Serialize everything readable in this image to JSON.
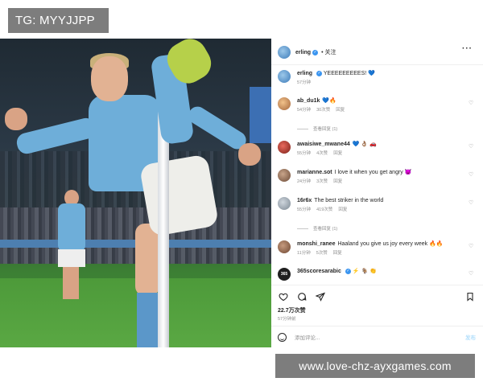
{
  "watermark_top": "TG: MYYJJPP",
  "watermark_bottom": "www.love-chz-ayxgames.com",
  "post": {
    "author": "erling",
    "follow_label": "关注",
    "more_label": "···",
    "caption": {
      "user": "erling",
      "text": "YEEEEEEEEES! 💙",
      "time": "57分钟"
    },
    "comments": [
      {
        "user": "ab_du1k",
        "text": "💙🔥",
        "time": "54分钟",
        "likes": "30次赞",
        "reply": "回复",
        "replies": "查看回复 (1)"
      },
      {
        "user": "awaisiwe_mwane44",
        "text": "💙 👌🏽 🚗",
        "time": "55分钟",
        "likes": "4次赞",
        "reply": "回复"
      },
      {
        "user": "marianne.sot",
        "text": "I love it when you get angry 😈",
        "time": "24分钟",
        "likes": "3次赞",
        "reply": "回复"
      },
      {
        "user": "16r6x",
        "text": "The best striker in the world",
        "time": "55分钟",
        "likes": "419次赞",
        "reply": "回复",
        "replies": "查看回复 (1)"
      },
      {
        "user": "monshi_ranee",
        "text": "Haaland you give us joy every week 🔥🔥",
        "time": "11分钟",
        "likes": "5次赞",
        "reply": "回复"
      },
      {
        "user": "365scoresarabic",
        "text": "⚡ 🐐 👏",
        "time": "",
        "likes": "",
        "reply": ""
      }
    ],
    "likes": "22.7万次赞",
    "date": "57分钟前",
    "add_comment_placeholder": "添加评论...",
    "post_button": "发布"
  },
  "colors": {
    "verified": "#3b95f0",
    "watermark_bg": "#7d7d7d",
    "kit_blue": "#6eaed9"
  }
}
